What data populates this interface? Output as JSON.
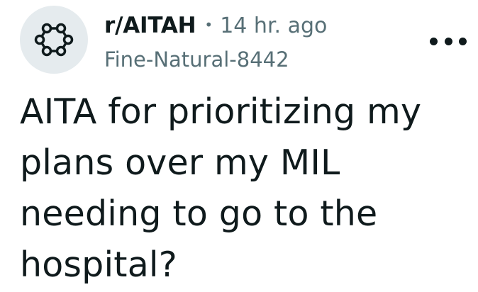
{
  "post": {
    "subreddit": "r/AITAH",
    "separator": "•",
    "time_ago": "14 hr. ago",
    "author": "Fine-Natural-8442",
    "title": "AITA for prioritizing my plans over my MIL needing to go to the hospital?"
  },
  "icons": {
    "avatar": "subreddit-community-icon",
    "menu": "overflow-menu-icon"
  },
  "colors": {
    "text_primary": "#0f1a1c",
    "text_secondary": "#576f76",
    "avatar_bg": "#e5ebee"
  }
}
